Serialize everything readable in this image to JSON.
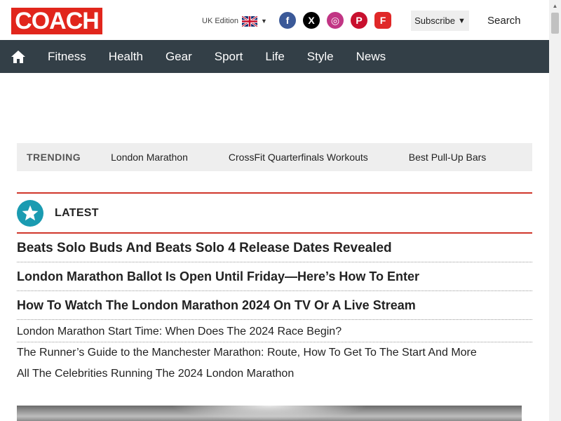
{
  "header": {
    "logo": "COACH",
    "edition": "UK Edition",
    "subscribe": "Subscribe",
    "search": "Search",
    "socials": [
      {
        "icon": "facebook-icon",
        "glyph": "f"
      },
      {
        "icon": "x-icon",
        "glyph": "X"
      },
      {
        "icon": "instagram-icon",
        "glyph": "◎"
      },
      {
        "icon": "pinterest-icon",
        "glyph": "P"
      },
      {
        "icon": "flipboard-icon",
        "glyph": "F"
      }
    ]
  },
  "nav": {
    "items": [
      "Fitness",
      "Health",
      "Gear",
      "Sport",
      "Life",
      "Style",
      "News"
    ]
  },
  "trending": {
    "label": "TRENDING",
    "items": [
      "London Marathon",
      "CrossFit Quarterfinals Workouts",
      "Best Pull-Up Bars"
    ]
  },
  "latest": {
    "title": "LATEST",
    "articles": [
      "Beats Solo Buds And Beats Solo 4 Release Dates Revealed",
      "London Marathon Ballot Is Open Until Friday—Here’s How To Enter",
      "How To Watch The London Marathon 2024 On TV Or A Live Stream",
      "London Marathon Start Time: When Does The 2024 Race Begin?",
      "The Runner’s Guide to the Manchester Marathon: Route, How To Get To The Start And More",
      "All The Celebrities Running The 2024 London Marathon"
    ]
  },
  "colors": {
    "brand_red": "#e1261c",
    "nav_bg": "#333f47",
    "accent_teal": "#1a9bb1",
    "divider_red": "#d0362b"
  }
}
